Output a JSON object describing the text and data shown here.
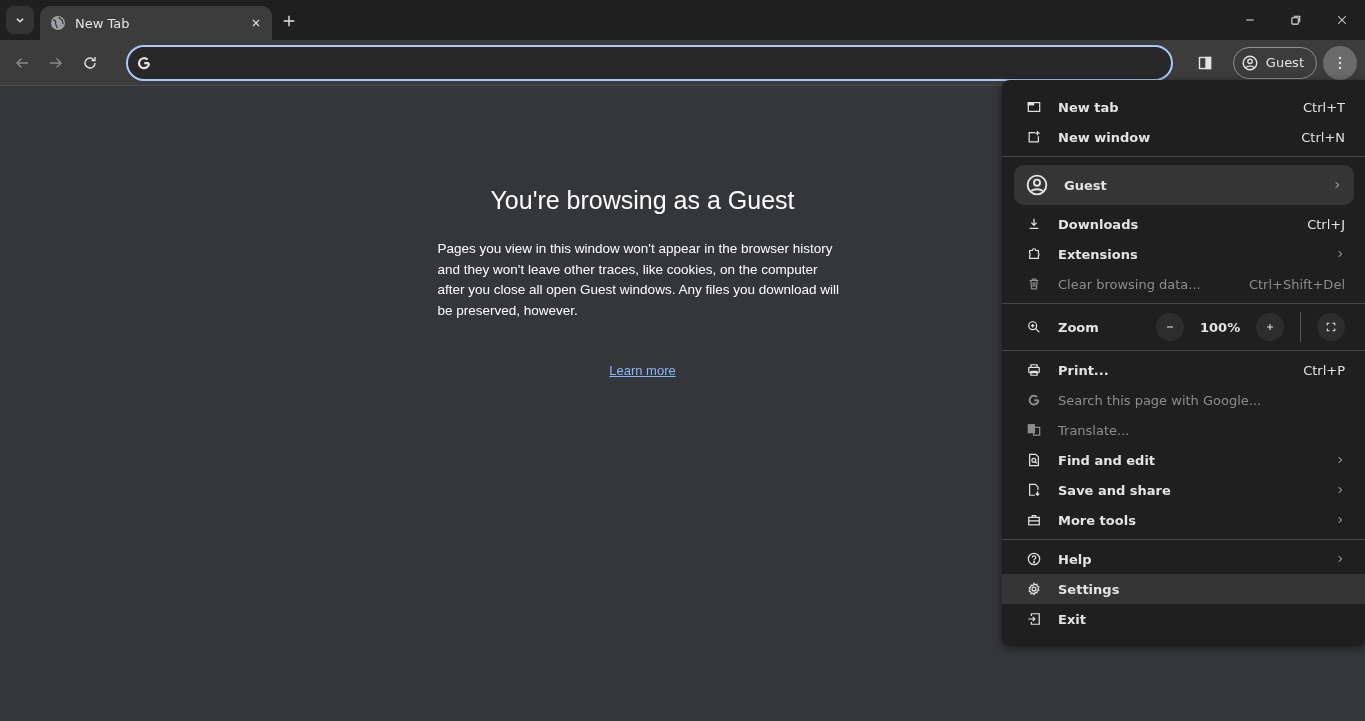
{
  "tabs": [
    {
      "title": "New Tab",
      "selected": true
    }
  ],
  "toolbar": {
    "profile_label": "Guest"
  },
  "page": {
    "heading": "You're browsing as a Guest",
    "body": "Pages you view in this window won't appear in the browser history and they won't leave other traces, like cookies, on the computer after you close all open Guest windows. Any files you download will be preserved, however.",
    "link": "Learn more"
  },
  "menu": {
    "sections": [
      [
        {
          "kind": "item",
          "label": "New tab",
          "shortcut": "Ctrl+T",
          "disabled": false,
          "highlighted": false
        },
        {
          "kind": "item",
          "label": "New window",
          "shortcut": "Ctrl+N",
          "disabled": false,
          "highlighted": false
        }
      ],
      [
        {
          "kind": "profile",
          "label": "Guest",
          "has_submenu": true,
          "disabled": false,
          "highlighted": true
        },
        {
          "kind": "item",
          "label": "Downloads",
          "shortcut": "Ctrl+J",
          "disabled": false,
          "highlighted": false
        },
        {
          "kind": "item",
          "label": "Extensions",
          "has_submenu": true,
          "disabled": false,
          "highlighted": false
        },
        {
          "kind": "item",
          "label": "Clear browsing data...",
          "shortcut": "Ctrl+Shift+Del",
          "disabled": true,
          "highlighted": false
        }
      ],
      [
        {
          "kind": "zoom",
          "label": "Zoom",
          "value": "100%",
          "disabled": false,
          "highlighted": false
        }
      ],
      [
        {
          "kind": "item",
          "label": "Print...",
          "shortcut": "Ctrl+P",
          "disabled": false,
          "highlighted": false
        },
        {
          "kind": "item",
          "label": "Search this page with Google...",
          "disabled": true,
          "highlighted": false
        },
        {
          "kind": "item",
          "label": "Translate...",
          "disabled": true,
          "highlighted": false
        },
        {
          "kind": "item",
          "label": "Find and edit",
          "has_submenu": true,
          "disabled": false,
          "highlighted": false
        },
        {
          "kind": "item",
          "label": "Save and share",
          "has_submenu": true,
          "disabled": false,
          "highlighted": false
        },
        {
          "kind": "item",
          "label": "More tools",
          "has_submenu": true,
          "disabled": false,
          "highlighted": false
        }
      ],
      [
        {
          "kind": "item",
          "label": "Help",
          "has_submenu": true,
          "disabled": false,
          "highlighted": false
        },
        {
          "kind": "item",
          "label": "Settings",
          "disabled": false,
          "highlighted": true
        },
        {
          "kind": "item",
          "label": "Exit",
          "disabled": false,
          "highlighted": false
        }
      ]
    ]
  }
}
